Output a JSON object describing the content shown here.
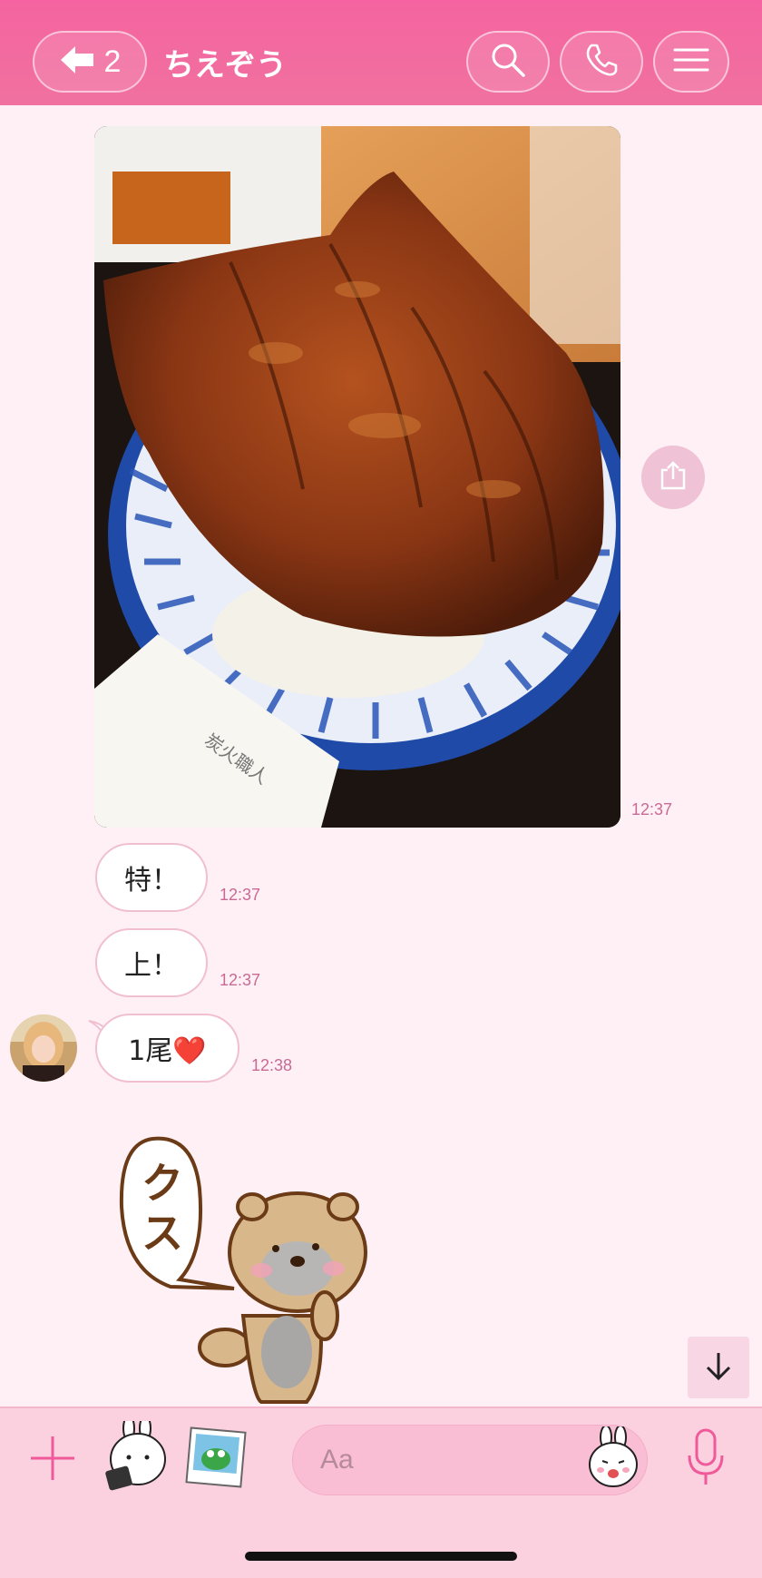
{
  "header": {
    "back_count": "2",
    "title": "ちえぞう"
  },
  "messages": [
    {
      "type": "image",
      "time": "12:37",
      "slip_text": "炭火職人"
    },
    {
      "type": "text",
      "text": "特！",
      "time": "12:37"
    },
    {
      "type": "text",
      "text": "上！",
      "time": "12:37"
    },
    {
      "type": "text",
      "text": "1尾❤️",
      "time": "12:38"
    },
    {
      "type": "sticker",
      "sticker_text": "クス"
    }
  ],
  "composer": {
    "placeholder": "Aa"
  },
  "colors": {
    "header": "#f564a0",
    "background": "#fff0f5",
    "footer": "#fbd0df",
    "accent": "#ef5a9a"
  },
  "icons": {
    "back": "arrow-left-icon",
    "search": "search-icon",
    "call": "phone-icon",
    "menu": "menu-icon",
    "share": "share-icon",
    "scroll": "arrow-down-icon",
    "add": "plus-icon",
    "stickers": "sticker-icon",
    "gallery": "photo-icon",
    "emoji": "emoji-icon",
    "mic": "microphone-icon"
  }
}
